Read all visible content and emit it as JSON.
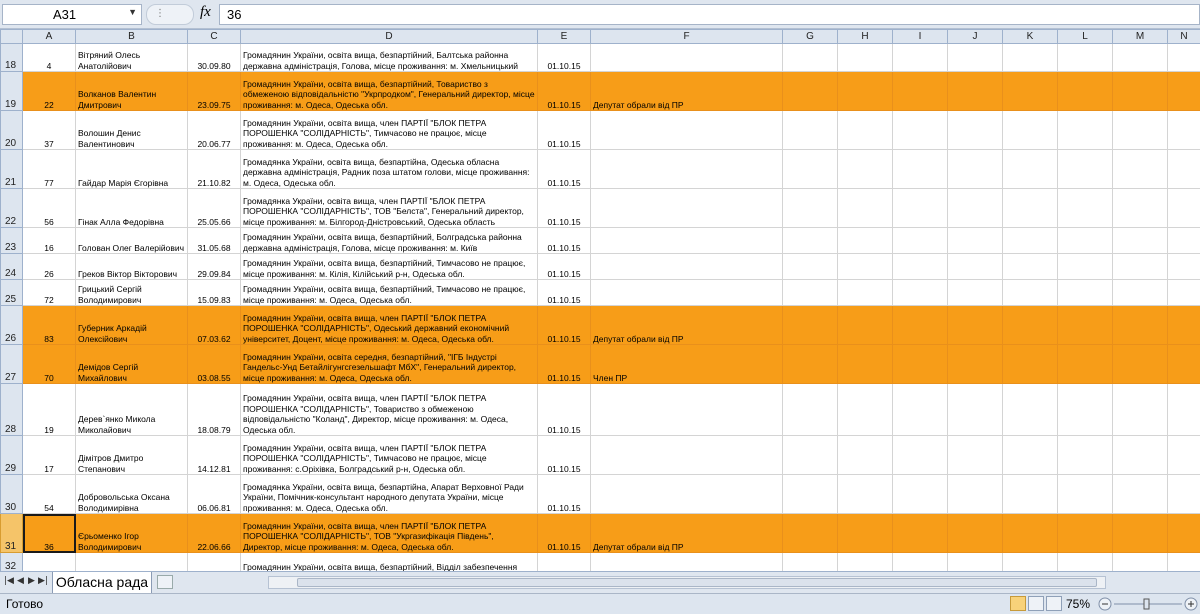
{
  "formula_bar": {
    "cell_ref": "A31",
    "fx": "fx",
    "value": "36"
  },
  "columns": [
    "A",
    "B",
    "C",
    "D",
    "E",
    "F",
    "G",
    "H",
    "I",
    "J",
    "K",
    "L",
    "M",
    "N"
  ],
  "rows": [
    {
      "n": "18",
      "a": "4",
      "b": "Вітряний Олесь Анатолійович",
      "c": "30.09.80",
      "d": "Громадянин України, освіта вища, безпартійний, Балтська районна державна адміністрація, Голова, місце проживання: м. Хмельницький",
      "e": "01.10.15",
      "f": "",
      "hl": false
    },
    {
      "n": "19",
      "a": "22",
      "b": "Волканов Валентин Дмитрович",
      "c": "23.09.75",
      "d": "Громадянин України, освіта вища, безпартійний, Товариство з обмеженою відповідальністю \"Укрпродком\", Генеральний директор, місце проживання: м. Одеса, Одеська обл.",
      "e": "01.10.15",
      "f": "Депутат обрали від ПР",
      "hl": true
    },
    {
      "n": "20",
      "a": "37",
      "b": "Волошин Денис Валентинович",
      "c": "20.06.77",
      "d": "Громадянин України, освіта вища, член ПАРТІЇ \"БЛОК ПЕТРА ПОРОШЕНКА \"СОЛІДАРНІСТЬ\", Тимчасово не працює, місце проживання: м. Одеса, Одеська обл.",
      "e": "01.10.15",
      "f": "",
      "hl": false
    },
    {
      "n": "21",
      "a": "77",
      "b": "Гайдар Марія Єгорівна",
      "c": "21.10.82",
      "d": "Громадянка України, освіта вища, безпартійна, Одеська обласна державна адміністрація, Радник поза штатом голови, місце проживання: м. Одеса, Одеська обл.",
      "e": "01.10.15",
      "f": "",
      "hl": false
    },
    {
      "n": "22",
      "a": "56",
      "b": "Гінак Алла Федорівна",
      "c": "25.05.66",
      "d": "Громадянка України, освіта вища, член ПАРТІЇ \"БЛОК ПЕТРА ПОРОШЕНКА \"СОЛІДАРНІСТЬ\", ТОВ \"Белста\", Генеральний директор, місце проживання: м. Білгород-Дністровський, Одеська область",
      "e": "01.10.15",
      "f": "",
      "hl": false
    },
    {
      "n": "23",
      "a": "16",
      "b": "Голован Олег Валерійович",
      "c": "31.05.68",
      "d": "Громадянин України, освіта вища, безпартійний, Болградська районна державна адміністрація, Голова, місце проживання: м. Київ",
      "e": "01.10.15",
      "f": "",
      "hl": false
    },
    {
      "n": "24",
      "a": "26",
      "b": "Греков Віктор Вікторович",
      "c": "29.09.84",
      "d": "Громадянин України, освіта вища, безпартійний, Тимчасово не працює, місце проживання: м. Кілія, Кілійський р-н, Одеська обл.",
      "e": "01.10.15",
      "f": "",
      "hl": false
    },
    {
      "n": "25",
      "a": "72",
      "b": "Грицький Сергій Володимирович",
      "c": "15.09.83",
      "d": "Громадянин України, освіта вища, безпартійний, Тимчасово не працює, місце проживання: м. Одеса, Одеська обл.",
      "e": "01.10.15",
      "f": "",
      "hl": false
    },
    {
      "n": "26",
      "a": "83",
      "b": "Губерник Аркадій Олексійович",
      "c": "07.03.62",
      "d": "Громадянин України, освіта вища, член ПАРТІЇ \"БЛОК ПЕТРА ПОРОШЕНКА \"СОЛІДАРНІСТЬ\", Одеський державний економічний університет, Доцент, місце проживання: м. Одеса, Одеська обл.",
      "e": "01.10.15",
      "f": "Депутат обрали від ПР",
      "hl": true
    },
    {
      "n": "27",
      "a": "70",
      "b": "Демідов Сергій Михайлович",
      "c": "03.08.55",
      "d": "Громадянин України, освіта середня, безпартійний, \"ІГБ Індустрі Гандельс-Унд Бетайлігунгсгезельшафт МбХ\", Генеральний директор, місце проживання: м. Одеса, Одеська обл.",
      "e": "01.10.15",
      "f": "Член ПР",
      "hl": true
    },
    {
      "n": "28",
      "a": "19",
      "b": "Дерев`янко Микола Миколайович",
      "c": "18.08.79",
      "d": "Громадянин України, освіта вища, член ПАРТІЇ \"БЛОК ПЕТРА ПОРОШЕНКА \"СОЛІДАРНІСТЬ\", Товариство з обмеженою відповідальністю \"Коланд\", Директор, місце проживання: м. Одеса, Одеська обл.",
      "e": "01.10.15",
      "f": "",
      "hl": false
    },
    {
      "n": "29",
      "a": "17",
      "b": "Дімітров Дмитро Степанович",
      "c": "14.12.81",
      "d": "Громадянин України, освіта вища, член ПАРТІЇ \"БЛОК ПЕТРА ПОРОШЕНКА \"СОЛІДАРНІСТЬ\", Тимчасово не працює, місце проживання: с.Оріхівка, Болградський р-н, Одеська обл.",
      "e": "01.10.15",
      "f": "",
      "hl": false
    },
    {
      "n": "30",
      "a": "54",
      "b": "Добровольська Оксана Володимирівна",
      "c": "06.06.81",
      "d": "Громадянка України, освіта вища, безпартійна, Апарат Верховної Ради України, Помічник-консультант народного депутата України, місце проживання: м. Одеса, Одеська обл.",
      "e": "01.10.15",
      "f": "",
      "hl": false
    },
    {
      "n": "31",
      "a": "36",
      "b": "Єрьоменко Ігор Володимирович",
      "c": "22.06.66",
      "d": "Громадянин України, освіта вища, член ПАРТІЇ \"БЛОК ПЕТРА ПОРОШЕНКА \"СОЛІДАРНІСТЬ\", ТОВ \"Укргазифікація Південь\", Директор, місце проживання: м. Одеса, Одеська обл.",
      "e": "01.10.15",
      "f": "Депутат обрали від ПР",
      "hl": true
    },
    {
      "n": "32",
      "a": "",
      "b": "",
      "c": "",
      "d": "Громадянин України, освіта вища, безпартійний, Відділ забезпечення",
      "e": "",
      "f": "",
      "hl": false
    }
  ],
  "sheet_tab": "Обласна рада",
  "status": "Готово",
  "zoom": "75%",
  "colors": {
    "highlight": "#f79d18",
    "header_bg": "#dde5ef"
  }
}
